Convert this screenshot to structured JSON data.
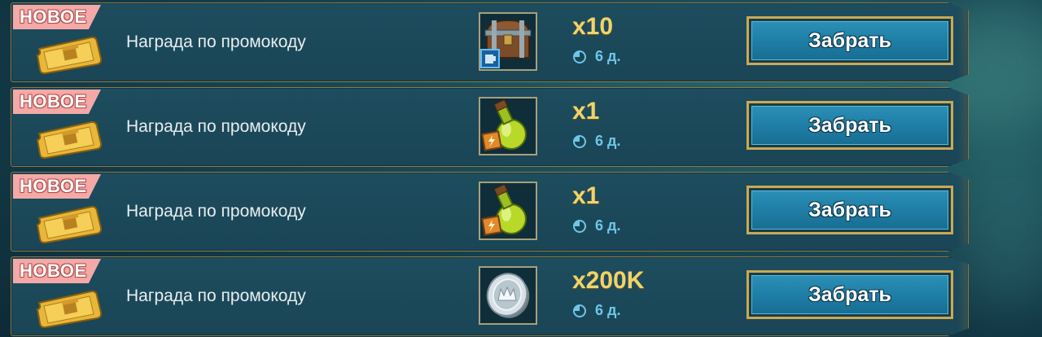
{
  "rewards": [
    {
      "badge": "НОВОЕ",
      "title": "Награда по промокоду",
      "item_icon": "chest-icon",
      "quantity": "x10",
      "time_left": "6 д.",
      "claim_label": "Забрать"
    },
    {
      "badge": "НОВОЕ",
      "title": "Награда по промокоду",
      "item_icon": "energy-potion-icon",
      "quantity": "x1",
      "time_left": "6 д.",
      "claim_label": "Забрать"
    },
    {
      "badge": "НОВОЕ",
      "title": "Награда по промокоду",
      "item_icon": "energy-potion-icon",
      "quantity": "x1",
      "time_left": "6 д.",
      "claim_label": "Забрать"
    },
    {
      "badge": "НОВОЕ",
      "title": "Награда по промокоду",
      "item_icon": "silver-coin-icon",
      "quantity": "x200K",
      "time_left": "6 д.",
      "claim_label": "Забрать"
    }
  ],
  "colors": {
    "accent_gold": "#f1d36a",
    "timer_blue": "#6fc6e8",
    "badge_pink": "#f4a9a7",
    "button_blue": "#1f7ea6"
  }
}
